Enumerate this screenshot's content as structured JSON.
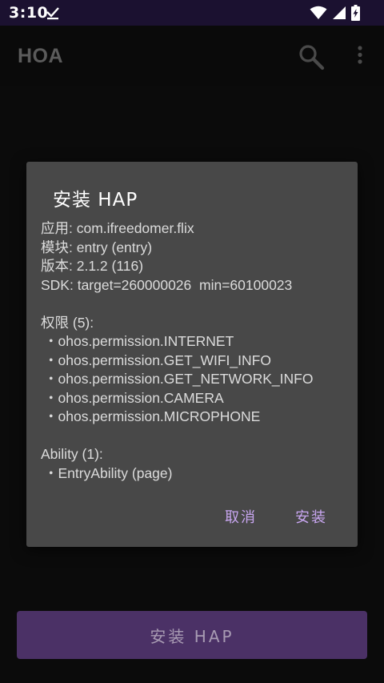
{
  "status_bar": {
    "time": "3:10"
  },
  "app_bar": {
    "title": "HOA"
  },
  "dialog": {
    "title": "安装 HAP",
    "app_line": "应用: com.ifreedomer.flix",
    "module_line": "模块: entry (entry)",
    "version_line": "版本: 2.1.2 (116)",
    "sdk_line": "SDK: target=260000026  min=60100023",
    "permissions_header": "权限 (5):",
    "permissions": [
      "・ohos.permission.INTERNET",
      "・ohos.permission.GET_WIFI_INFO",
      "・ohos.permission.GET_NETWORK_INFO",
      "・ohos.permission.CAMERA",
      "・ohos.permission.MICROPHONE"
    ],
    "ability_header": "Ability (1):",
    "abilities": [
      "・EntryAbility (page)"
    ],
    "cancel_label": "取消",
    "install_label": "安装"
  },
  "main_button": {
    "label": "安装 HAP"
  },
  "colors": {
    "accent": "#c8a6f0",
    "primary_button": "#4b3166",
    "dialog_bg": "#484848",
    "status_bar_bg": "#1b1130"
  }
}
